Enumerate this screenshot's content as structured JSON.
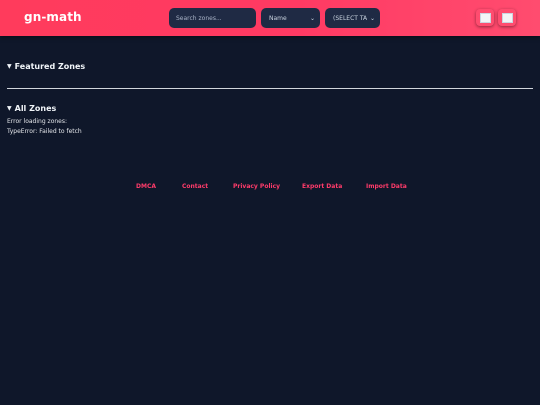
{
  "header": {
    "brand": "gn-math",
    "search_placeholder": "Search zones...",
    "sort_select": "Name",
    "tag_select": "(SELECT TAG)",
    "icon_buttons": [
      {
        "icon": "settings-icon"
      },
      {
        "icon": "theme-icon"
      }
    ]
  },
  "featured": {
    "title": "Featured Zones"
  },
  "all_zones": {
    "title": "All Zones",
    "error_line1": "Error loading zones:",
    "error_line2": "TypeError: Failed to fetch"
  },
  "footer": {
    "links": [
      "DMCA",
      "Contact",
      "Privacy Policy",
      "Export Data",
      "Import Data"
    ]
  },
  "colors": {
    "accent": "#ff3b5c",
    "background": "#0f172a",
    "control_bg": "#1f2a44",
    "footer_link": "#ff3b6a"
  }
}
